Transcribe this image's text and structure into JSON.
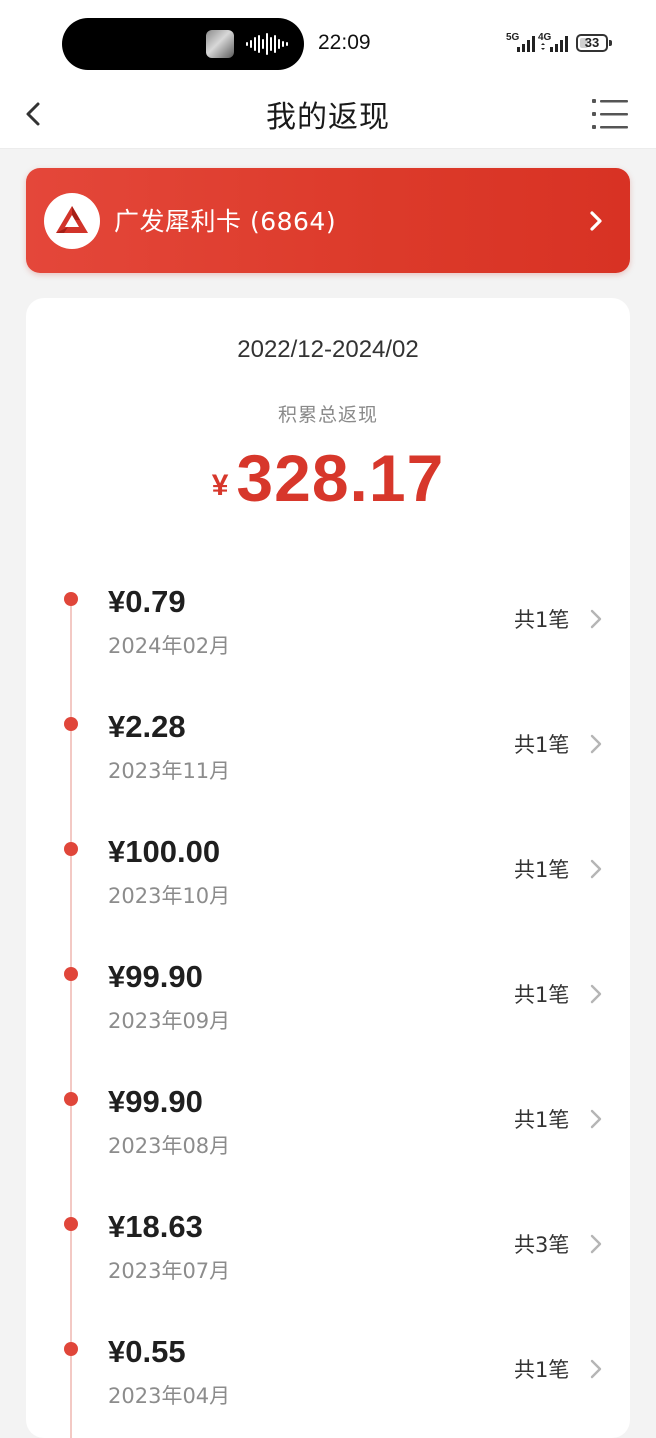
{
  "status_bar": {
    "time": "22:09",
    "network_1": "5G",
    "network_2": "4G",
    "battery": "33",
    "battery_level": 0.33
  },
  "nav": {
    "title": "我的返现"
  },
  "card": {
    "name": "广发犀利卡 (6864)",
    "brand_color": "#dc3a2a"
  },
  "summary": {
    "period": "2022/12-2024/02",
    "label": "积累总返现",
    "currency": "¥",
    "total": "328.17",
    "accent_color": "#d7372b"
  },
  "entries": [
    {
      "amount": "¥0.79",
      "month": "2024年02月",
      "count": "共1笔"
    },
    {
      "amount": "¥2.28",
      "month": "2023年11月",
      "count": "共1笔"
    },
    {
      "amount": "¥100.00",
      "month": "2023年10月",
      "count": "共1笔"
    },
    {
      "amount": "¥99.90",
      "month": "2023年09月",
      "count": "共1笔"
    },
    {
      "amount": "¥99.90",
      "month": "2023年08月",
      "count": "共1笔"
    },
    {
      "amount": "¥18.63",
      "month": "2023年07月",
      "count": "共3笔"
    },
    {
      "amount": "¥0.55",
      "month": "2023年04月",
      "count": "共1笔"
    }
  ]
}
